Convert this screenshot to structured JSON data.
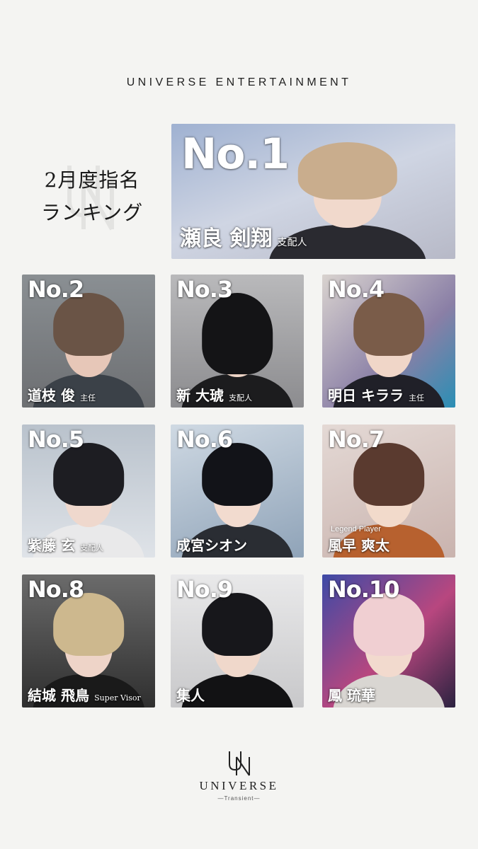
{
  "brand": {
    "top": "UNIVERSE ENTERTAINMENT",
    "logo_text": "UNIVERSE",
    "tagline": "—Transient—"
  },
  "title": {
    "line1": "2月度指名",
    "line2": "ランキング"
  },
  "ranking": [
    {
      "rank": "No.1",
      "name": "瀬良 剣翔",
      "role": "支配人",
      "subtitle": ""
    },
    {
      "rank": "No.2",
      "name": "道枝 俊",
      "role": "主任",
      "subtitle": ""
    },
    {
      "rank": "No.3",
      "name": "新 大琥",
      "role": "支配人",
      "subtitle": ""
    },
    {
      "rank": "No.4",
      "name": "明日 キララ",
      "role": "主任",
      "subtitle": ""
    },
    {
      "rank": "No.5",
      "name": "紫藤 玄",
      "role": "支配人",
      "subtitle": ""
    },
    {
      "rank": "No.6",
      "name": "成宮シオン",
      "role": "",
      "subtitle": ""
    },
    {
      "rank": "No.7",
      "name": "風早 爽太",
      "role": "",
      "subtitle": "Legend Player"
    },
    {
      "rank": "No.8",
      "name": "結城 飛鳥",
      "role": "Super Visor",
      "subtitle": ""
    },
    {
      "rank": "No.9",
      "name": "集人",
      "role": "",
      "subtitle": ""
    },
    {
      "rank": "No.10",
      "name": "鳳 琉華",
      "role": "",
      "subtitle": ""
    }
  ]
}
